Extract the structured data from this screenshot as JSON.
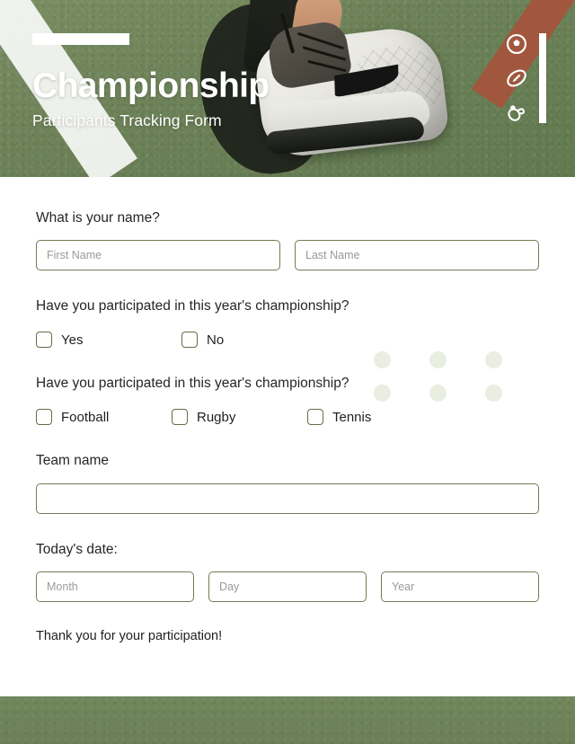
{
  "header": {
    "title": "Championship",
    "subtitle": "Participants Tracking Form",
    "icons": [
      {
        "name": "soccer-ball-icon"
      },
      {
        "name": "rugby-ball-icon"
      },
      {
        "name": "tennis-racket-icon"
      }
    ],
    "accent_color": "#ffffff",
    "background_color": "#6e8359",
    "clay_color": "#a5543c"
  },
  "form": {
    "name_question": "What is your name?",
    "first_name_placeholder": "First Name",
    "last_name_placeholder": "Last Name",
    "participation_question": "Have you participated in this year's championship?",
    "participation_options": [
      "Yes",
      "No"
    ],
    "sport_question": "Have you participated in this year's championship?",
    "sport_options": [
      "Football",
      "Rugby",
      "Tennis"
    ],
    "team_label": "Team name",
    "team_value": "",
    "date_label": "Today's date:",
    "month_placeholder": "Month",
    "day_placeholder": "Day",
    "year_placeholder": "Year",
    "thank_you": "Thank you for your participation!"
  },
  "decor": {
    "dot_color": "#e9eee1",
    "dot_count": 6
  },
  "footer": {
    "background_color": "#6a7f56"
  }
}
